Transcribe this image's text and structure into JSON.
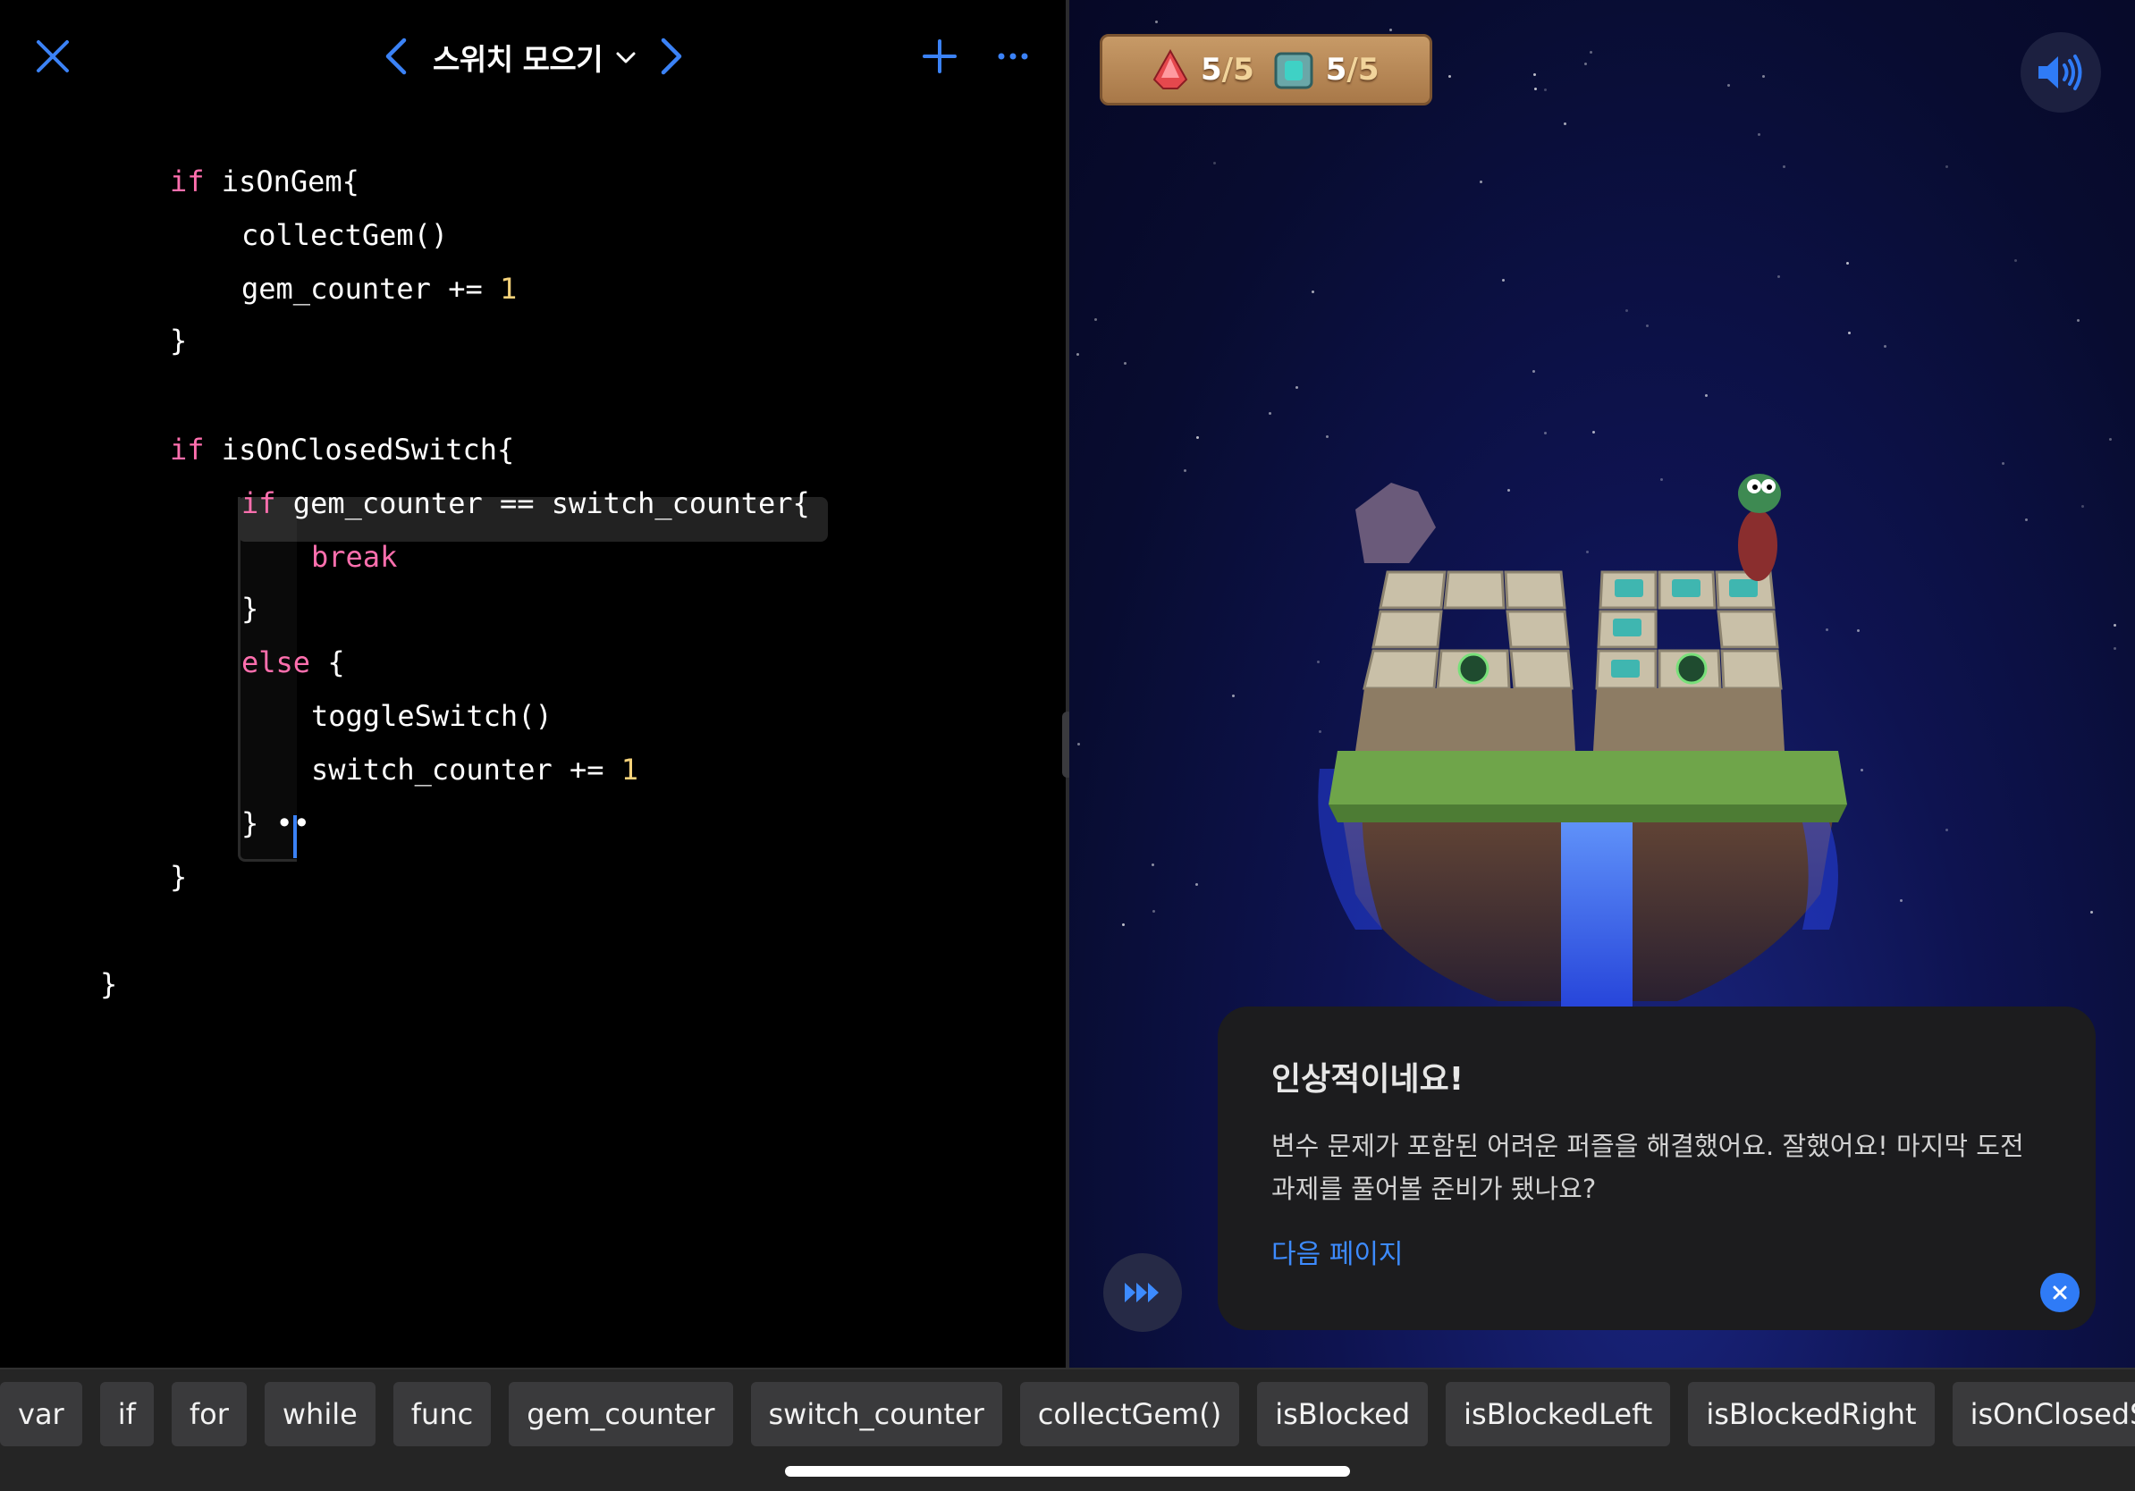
{
  "toolbar": {
    "page_title": "스위치 모으기",
    "close_icon": "close-icon",
    "prev_icon": "chevron-left-icon",
    "next_icon": "chevron-right-icon",
    "add_icon": "plus-icon",
    "more_icon": "ellipsis-icon"
  },
  "code": {
    "l1_kw": "if",
    "l1_rest": " isOnGem{",
    "l2": "collectGem()",
    "l3_rest": "gem_counter += ",
    "l3_num": "1",
    "l4": "}",
    "l5_kw": "if",
    "l5_rest": " isOnClosedSwitch{",
    "l6_kw": "if",
    "l6_rest": " gem_counter == switch_counter{",
    "l7_kw": "break",
    "l8": "}",
    "l9_kw": "else",
    "l9_rest": " {",
    "l10": "toggleSwitch()",
    "l11_rest": "switch_counter += ",
    "l11_num": "1",
    "l12": "} ••",
    "l13": "}",
    "l14": "}"
  },
  "live_view": {
    "gems_collected": "5",
    "gems_total": "/5",
    "switches_on": "5",
    "switches_total": "/5",
    "sound_icon": "speaker-icon",
    "fast_forward_icon": "fast-forward-icon"
  },
  "hint": {
    "title": "인상적이네요!",
    "body": "변수 문제가 포함된 어려운 퍼즐을 해결했어요. 잘했어요! 마지막 도전 과제를 풀어볼 준비가 됐나요?",
    "link": "다음 페이지"
  },
  "keywords": [
    "var",
    "if",
    "for",
    "while",
    "func",
    "gem_counter",
    "switch_counter",
    "collectGem()",
    "isBlocked",
    "isBlockedLeft",
    "isBlockedRight",
    "isOnClosedSw"
  ],
  "colors": {
    "accent": "#3b82f6",
    "keyword": "#ff6fae",
    "number": "#f5d27a",
    "link": "#3d8bff"
  }
}
